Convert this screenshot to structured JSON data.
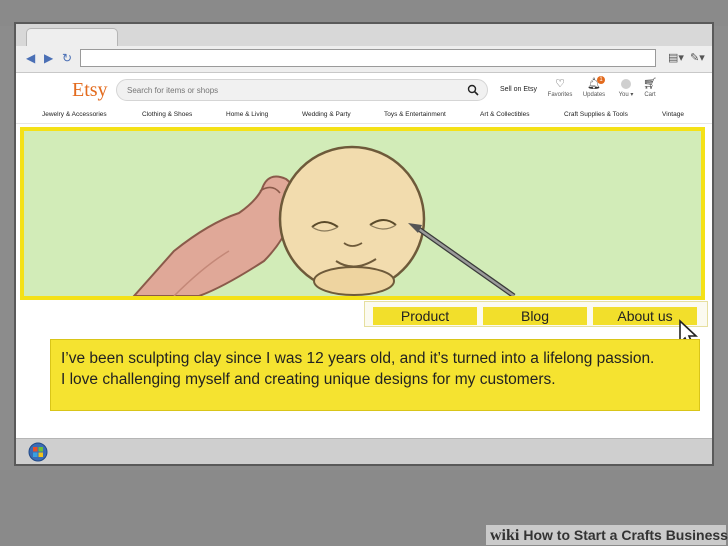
{
  "store": {
    "logo": "Etsy",
    "search_placeholder": "Search for items or shops",
    "sell_label": "Sell on Etsy",
    "header_icons": [
      {
        "icon": "heart-icon",
        "label": "Favorites"
      },
      {
        "icon": "bell-icon",
        "label": "Updates",
        "badge": "1"
      },
      {
        "icon": "user-icon",
        "label": "You ▾"
      },
      {
        "icon": "cart-icon",
        "label": "Cart"
      }
    ],
    "categories": [
      "Jewelry & Accessories",
      "Clothing & Shoes",
      "Home & Living",
      "Wedding & Party",
      "Toys & Entertainment",
      "Art & Collectibles",
      "Craft Supplies & Tools",
      "Vintage"
    ],
    "colors": {
      "logo": "#e36b1e",
      "hero_bg": "#d2ecb8",
      "highlight": "#f2df2b"
    }
  },
  "shop_nav": {
    "tabs": [
      "Product",
      "Blog",
      "About us"
    ]
  },
  "bio": {
    "line1": "I’ve been sculpting clay since I was 12 years old, and it’s turned into a lifelong passion.",
    "line2": "I love challenging myself and creating unique designs for my customers."
  },
  "watermark": {
    "brand": "wiki",
    "title": "How to Start a Crafts Business"
  }
}
